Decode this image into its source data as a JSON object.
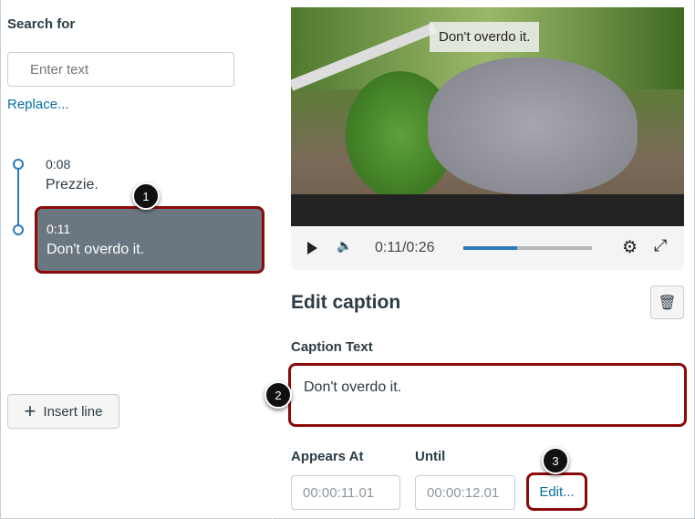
{
  "search": {
    "label": "Search for",
    "placeholder": "Enter text",
    "replace_link": "Replace..."
  },
  "captions": [
    {
      "time": "0:08",
      "text": "Prezzie."
    },
    {
      "time": "0:11",
      "text": "Don't overdo it."
    }
  ],
  "insert_line_label": "Insert line",
  "video": {
    "caption_overlay": "Don't overdo it.",
    "time_display": "0:11/0:26",
    "progress_fraction": 0.42,
    "accent": "#2b7abc"
  },
  "editor": {
    "title": "Edit caption",
    "caption_text_label": "Caption Text",
    "caption_text_value": "Don't overdo it.",
    "appears_at_label": "Appears At",
    "appears_at_value": "00:00:11.01",
    "until_label": "Until",
    "until_value": "00:00:12.01",
    "edit_link": "Edit..."
  },
  "callouts": [
    "1",
    "2",
    "3"
  ]
}
